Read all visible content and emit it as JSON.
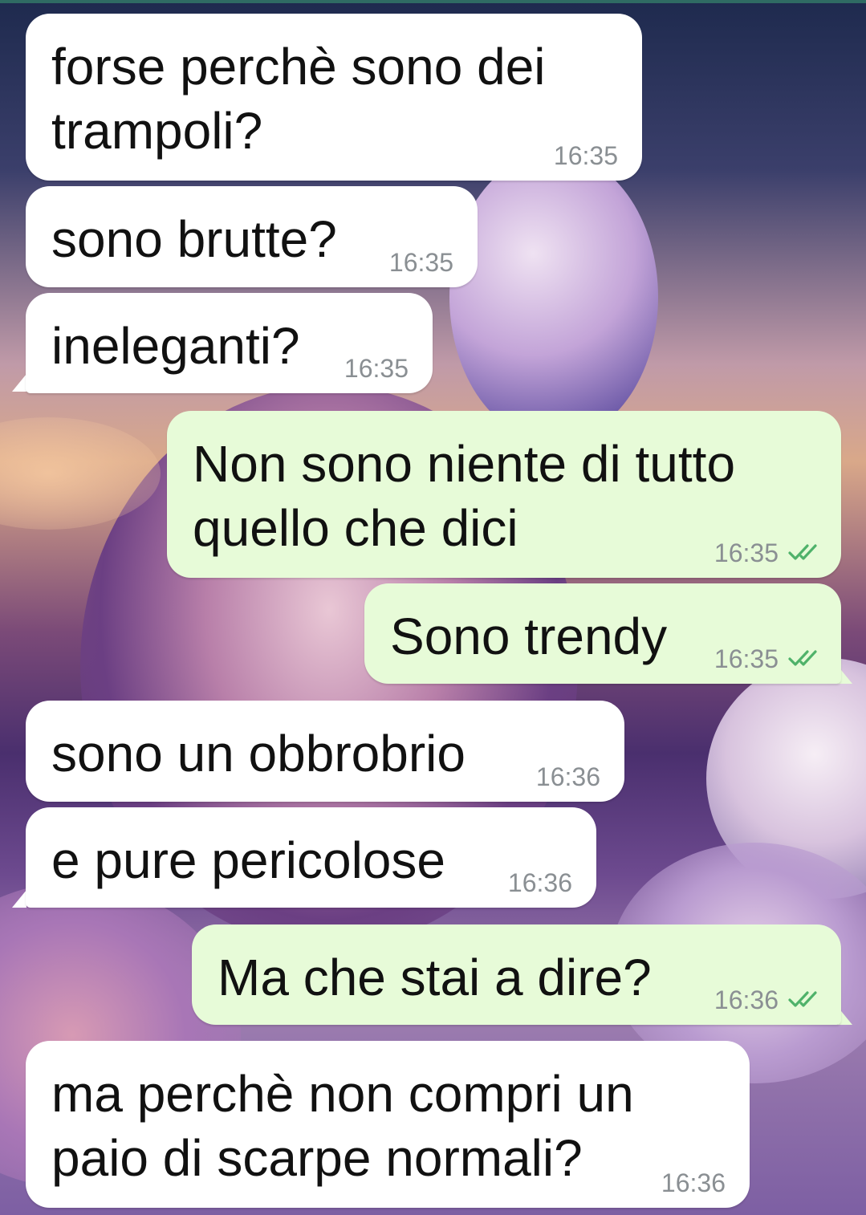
{
  "chat": {
    "messages": [
      {
        "direction": "incoming",
        "text_lines": [
          "forse perchè sono dei",
          "trampoli?"
        ],
        "time": "16:35"
      },
      {
        "direction": "incoming",
        "text_lines": [
          "sono brutte?"
        ],
        "time": "16:35"
      },
      {
        "direction": "incoming",
        "text_lines": [
          "ineleganti?"
        ],
        "time": "16:35"
      },
      {
        "direction": "outgoing",
        "text_lines": [
          "Non sono niente di tutto",
          "quello che dici"
        ],
        "time": "16:35",
        "status": "read"
      },
      {
        "direction": "outgoing",
        "text_lines": [
          "Sono trendy"
        ],
        "time": "16:35",
        "status": "read"
      },
      {
        "direction": "incoming",
        "text_lines": [
          "sono un obbrobrio"
        ],
        "time": "16:36"
      },
      {
        "direction": "incoming",
        "text_lines": [
          "e pure pericolose"
        ],
        "time": "16:36"
      },
      {
        "direction": "outgoing",
        "text_lines": [
          "Ma che stai a dire?"
        ],
        "time": "16:36",
        "status": "read"
      },
      {
        "direction": "incoming",
        "text_lines": [
          "ma perchè non compri un",
          "paio di scarpe normali?"
        ],
        "time": "16:36"
      }
    ]
  },
  "colors": {
    "incoming_bubble": "#ffffff",
    "outgoing_bubble": "#e7fbd8",
    "timestamp": "#8a8f93",
    "read_ticks": "#4fb26a"
  },
  "icons": {
    "read_status": "double-check-icon"
  }
}
